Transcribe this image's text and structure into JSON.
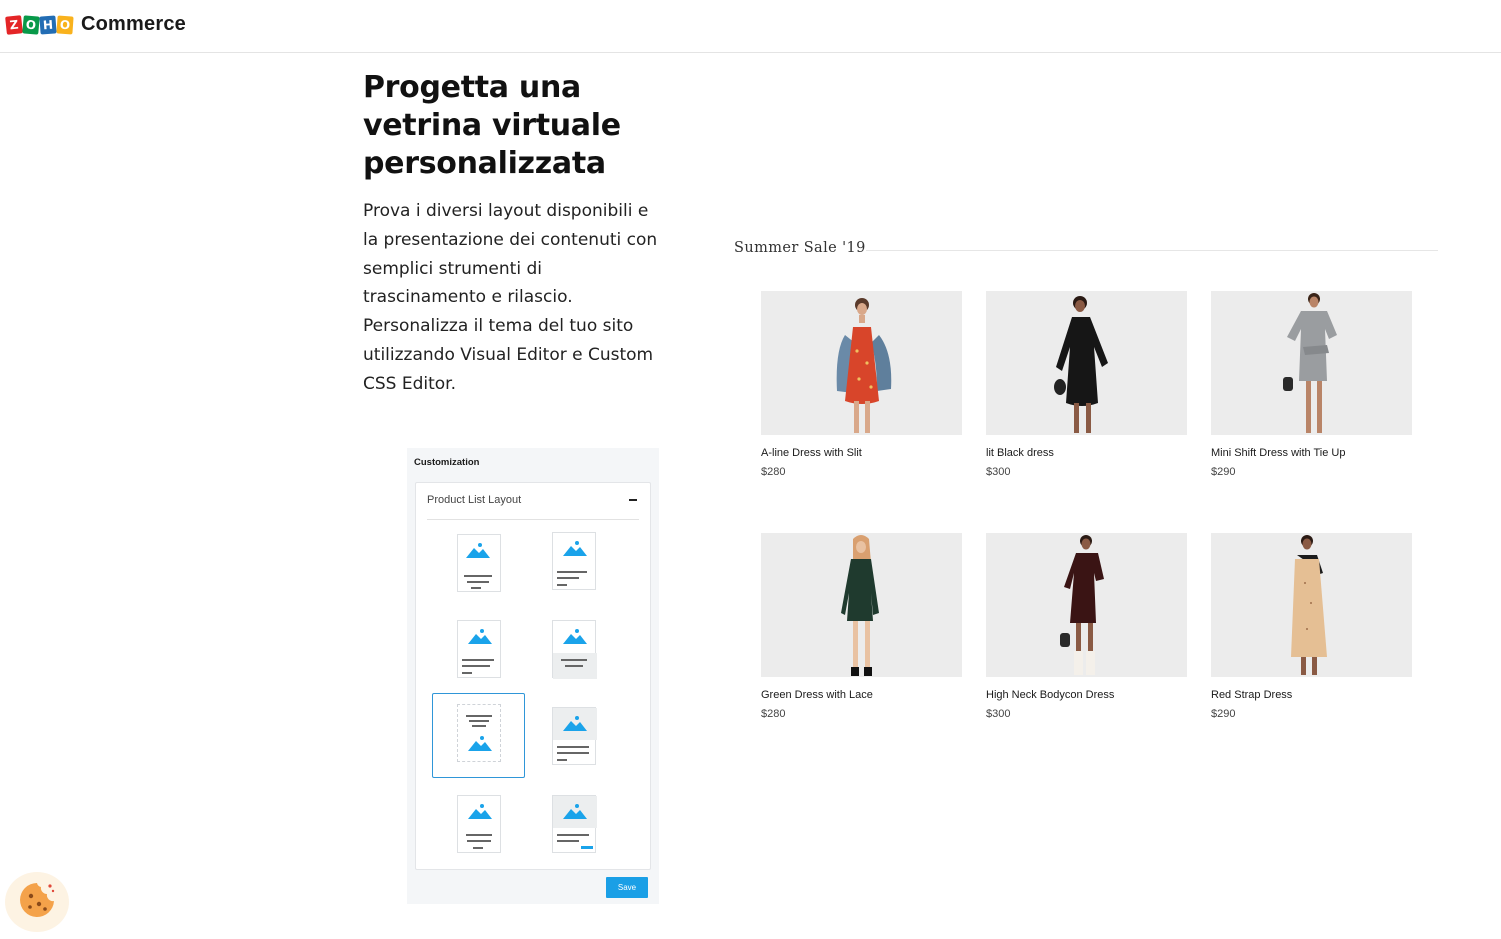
{
  "header": {
    "logo_letters": [
      "Z",
      "O",
      "H",
      "O"
    ],
    "logo_colors": [
      "#e42527",
      "#089949",
      "#226db4",
      "#f9b21d"
    ],
    "brand": "Commerce"
  },
  "hero": {
    "title": "Progetta una vetrina virtuale personalizzata",
    "description": "Prova i diversi layout disponibili e la presentazione dei contenuti con semplici strumenti di trascinamento e rilascio. Personalizza il tema del tuo sito utilizzando Visual Editor e Custom CSS Editor."
  },
  "customization": {
    "title": "Customization",
    "section_label": "Product List Layout",
    "layout_options_count_label": "",
    "save_label": "Save",
    "accent_color": "#1a9fe6",
    "selected_color": "#2f96d8"
  },
  "sale": {
    "title": "Summer Sale '19",
    "products": [
      {
        "name": "A-line Dress with Slit",
        "price": "$280"
      },
      {
        "name": "lit Black dress",
        "price": "$300"
      },
      {
        "name": "Mini Shift Dress with Tie Up",
        "price": "$290"
      },
      {
        "name": "Green Dress with Lace",
        "price": "$280"
      },
      {
        "name": "High Neck Bodycon Dress",
        "price": "$300"
      },
      {
        "name": "Red Strap Dress",
        "price": "$290"
      }
    ]
  },
  "cookie": {
    "icon": "cookie-icon"
  }
}
